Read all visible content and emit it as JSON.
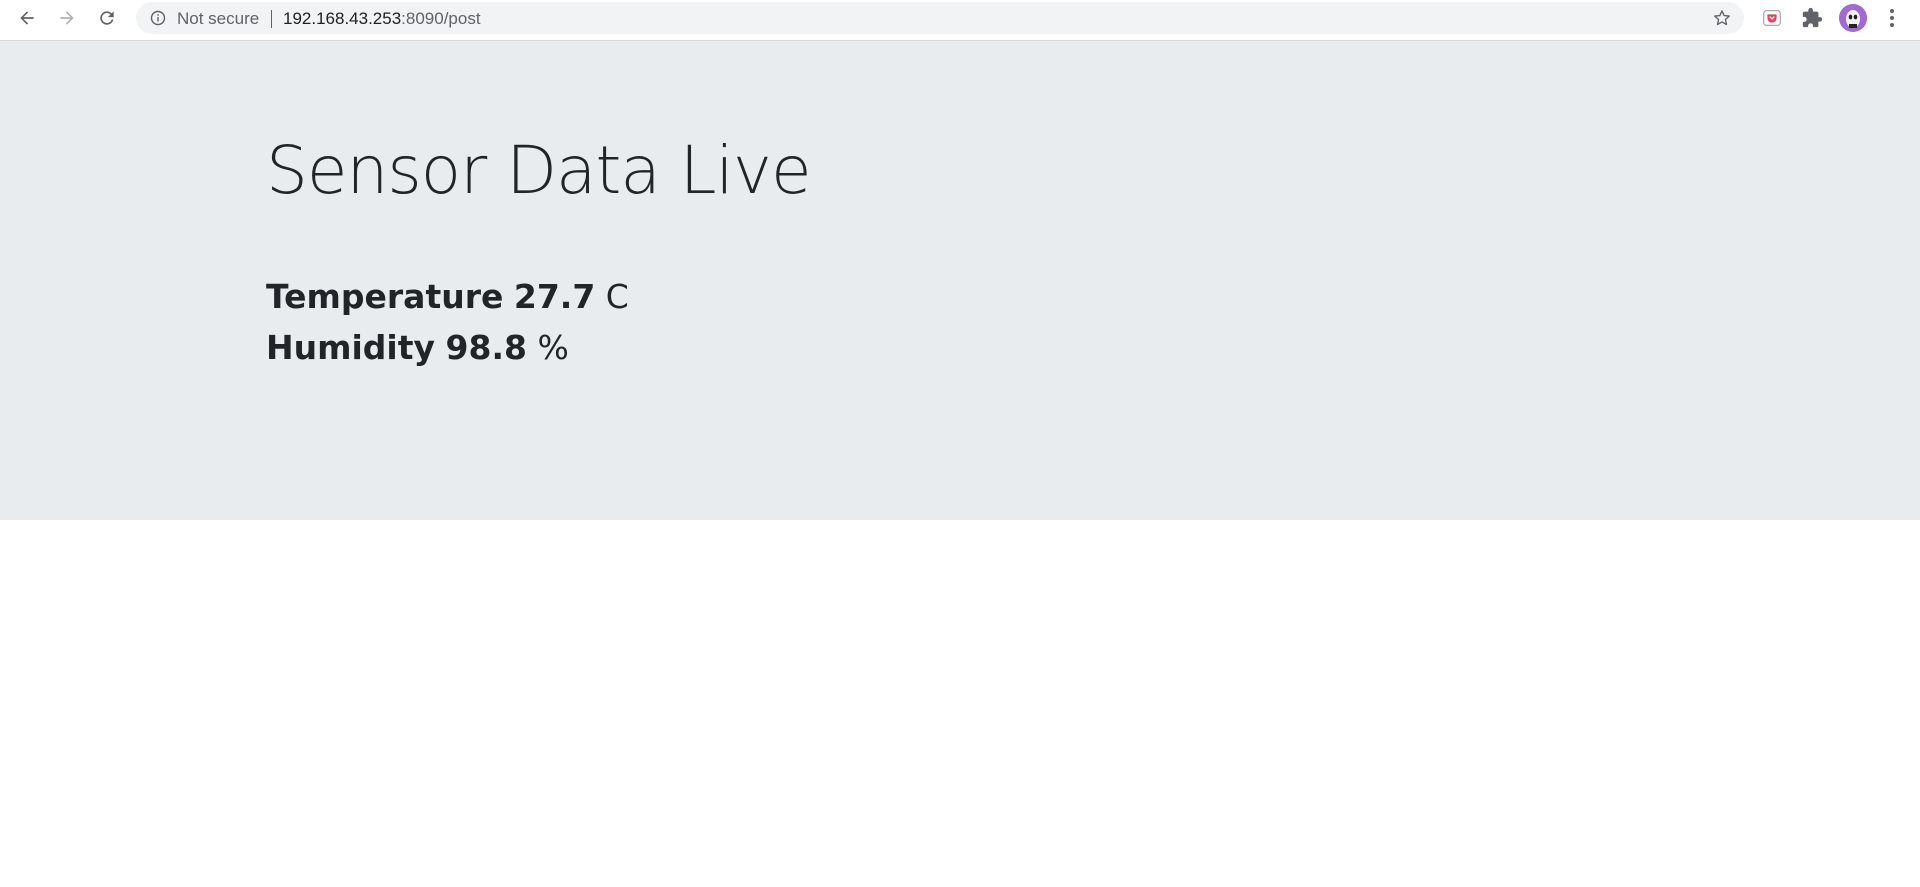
{
  "browser": {
    "security_label": "Not secure",
    "url_host": "192.168.43.253",
    "url_rest": ":8090/post"
  },
  "page": {
    "title": "Sensor Data Live",
    "temperature": {
      "label": "Temperature",
      "value": "27.7",
      "unit": "C"
    },
    "humidity": {
      "label": "Humidity",
      "value": "98.8",
      "unit": "%"
    }
  },
  "colors": {
    "jumbotron_bg": "#e9ecef",
    "text": "#212529",
    "avatar": "#a368d6"
  },
  "icons": [
    "back-arrow-icon",
    "forward-arrow-icon",
    "reload-icon",
    "info-icon",
    "star-icon",
    "extension-icon",
    "puzzle-icon",
    "profile-avatar",
    "menu-dots-icon"
  ]
}
